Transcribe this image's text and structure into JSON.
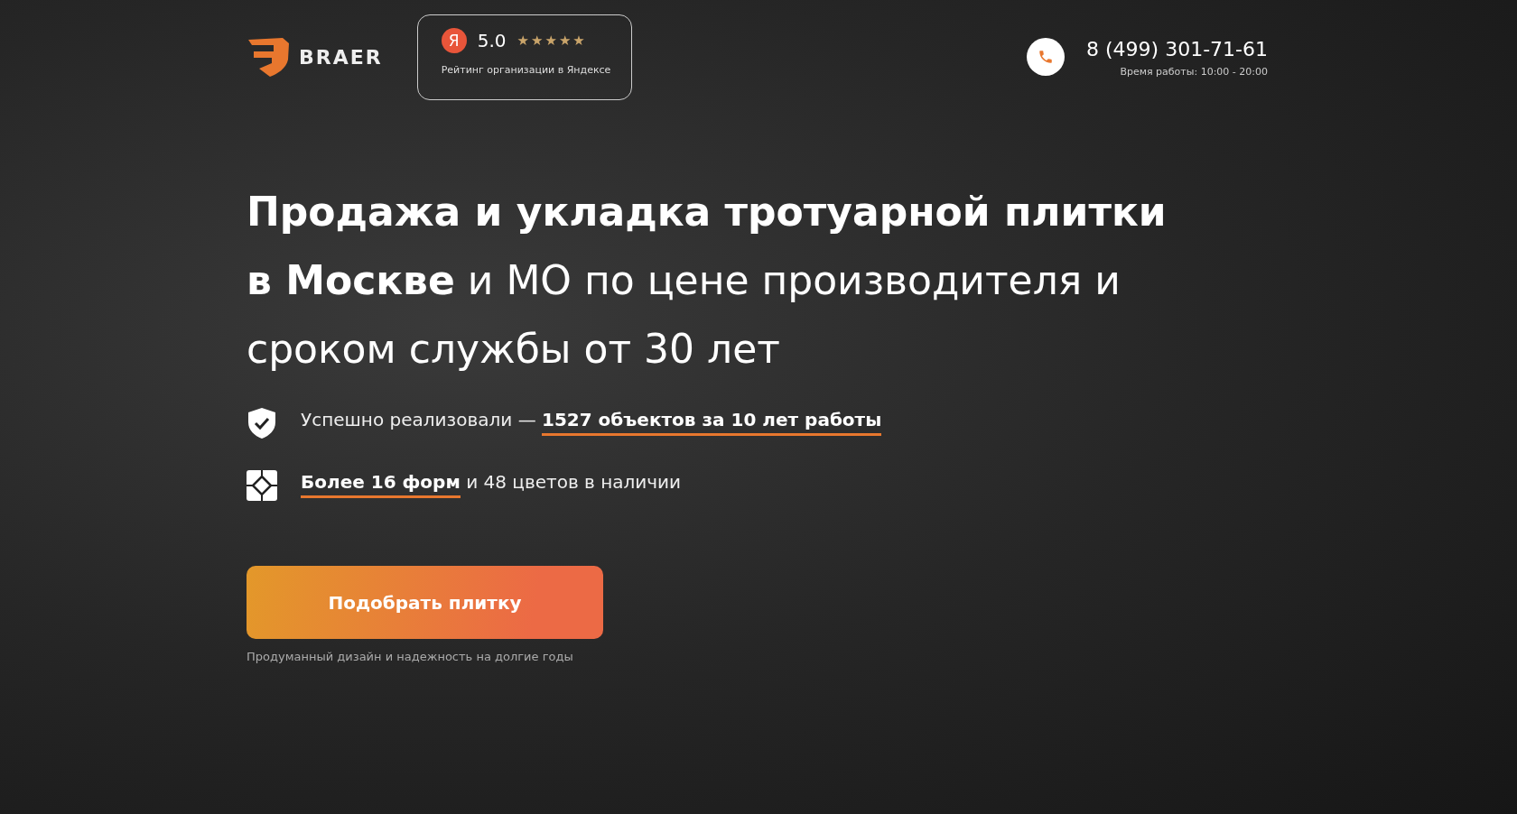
{
  "header": {
    "logo_text": "BRAER",
    "rating": {
      "badge_letter": "Я",
      "score": "5.0",
      "stars": 5,
      "caption": "Рейтинг организации в Яндексе"
    },
    "contact": {
      "phone": "8 (499) 301-71-61",
      "hours": "Время работы: 10:00 - 20:00"
    }
  },
  "hero": {
    "headline": "**Продажа и укладка тротуарной плитки в Москве** и МО по цене производителя и сроком службы от 30 лет",
    "benefits": [
      {
        "kind": "shield",
        "text": "Успешно реализовали — **1527 объектов за 10 лет работы**"
      },
      {
        "kind": "tile",
        "text": "**Более 16 форм** и 48 цветов в наличии"
      }
    ],
    "cta": {
      "label": "Подобрать плитку",
      "caption": "Продуманный дизайн и надежность на долгие годы"
    }
  }
}
